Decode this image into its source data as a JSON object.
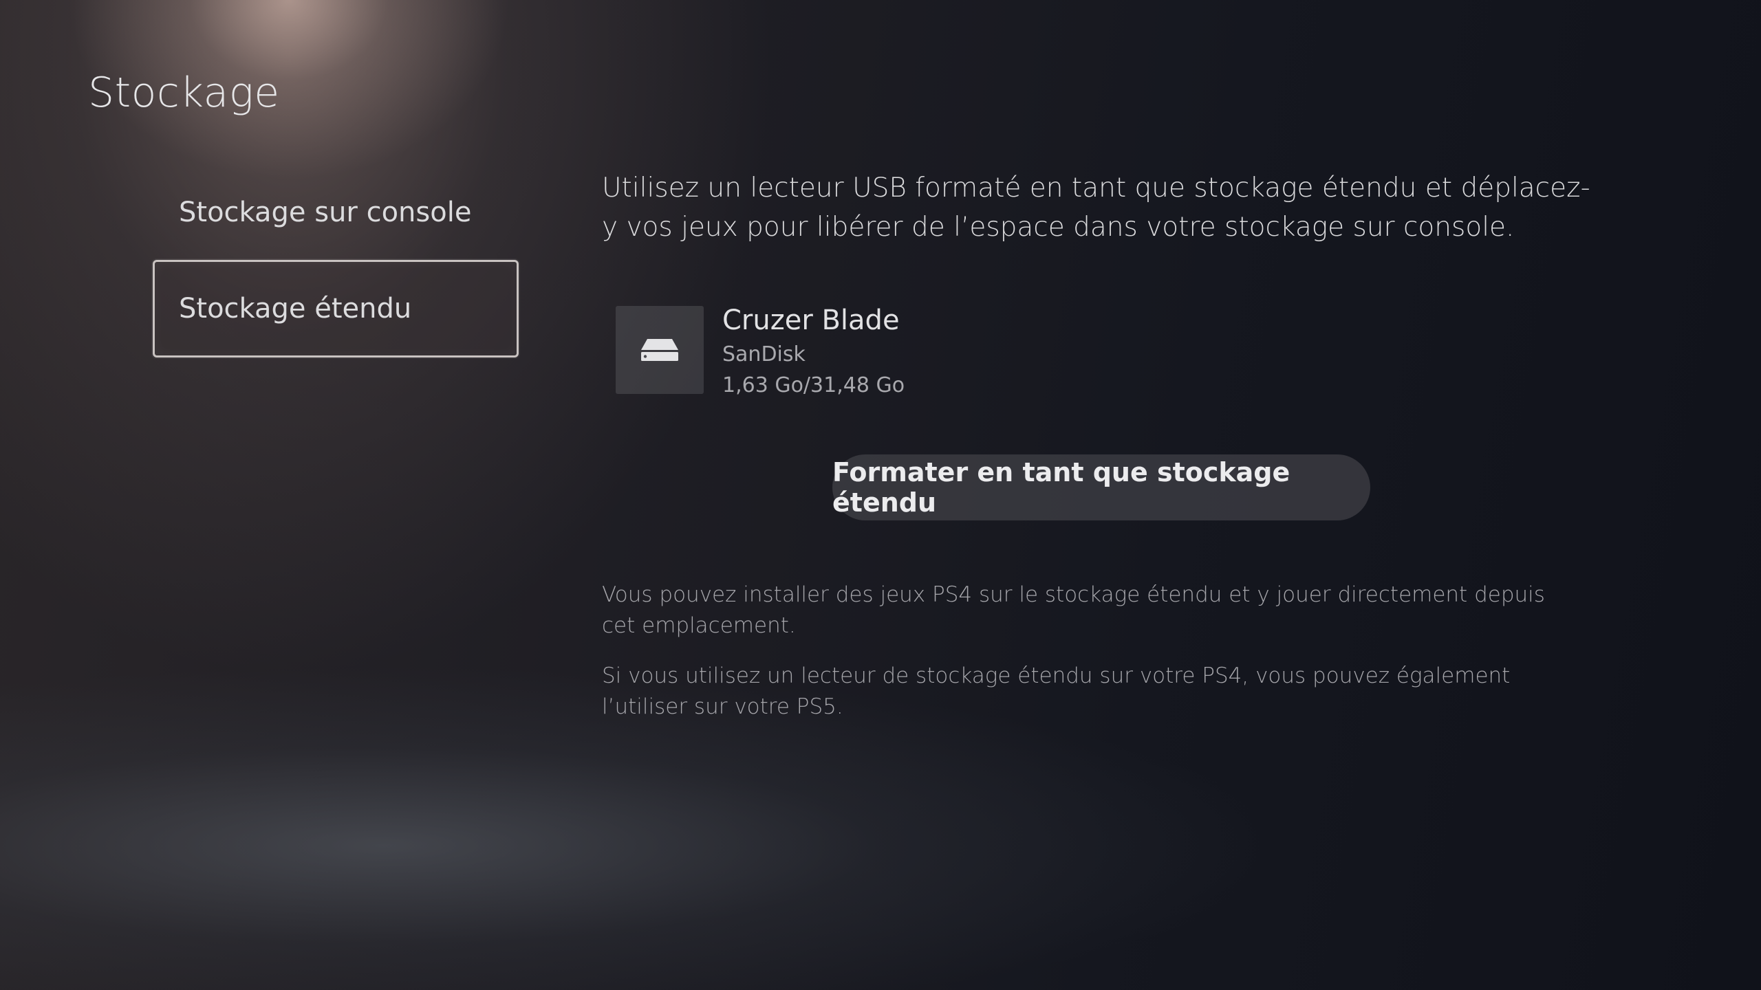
{
  "header": {
    "title": "Stockage"
  },
  "sidebar": {
    "items": [
      {
        "label": "Stockage sur console",
        "selected": false
      },
      {
        "label": "Stockage étendu",
        "selected": true
      }
    ]
  },
  "main": {
    "intro": "Utilisez un lecteur USB formaté en tant que stockage étendu et déplacez-y vos jeux pour libérer de l’espace dans votre stockage sur console.",
    "device": {
      "icon": "usb-drive-icon",
      "name": "Cruzer Blade",
      "brand": "SanDisk",
      "usage": "1,63 Go/31,48 Go"
    },
    "format_button_label": "Formater en tant que stockage étendu",
    "notes": [
      "Vous pouvez installer des jeux PS4 sur le stockage étendu et y jouer directement depuis cet emplacement.",
      "Si vous utilisez un lecteur de stockage étendu sur votre PS4, vous pouvez également l’utiliser sur votre PS5."
    ]
  }
}
